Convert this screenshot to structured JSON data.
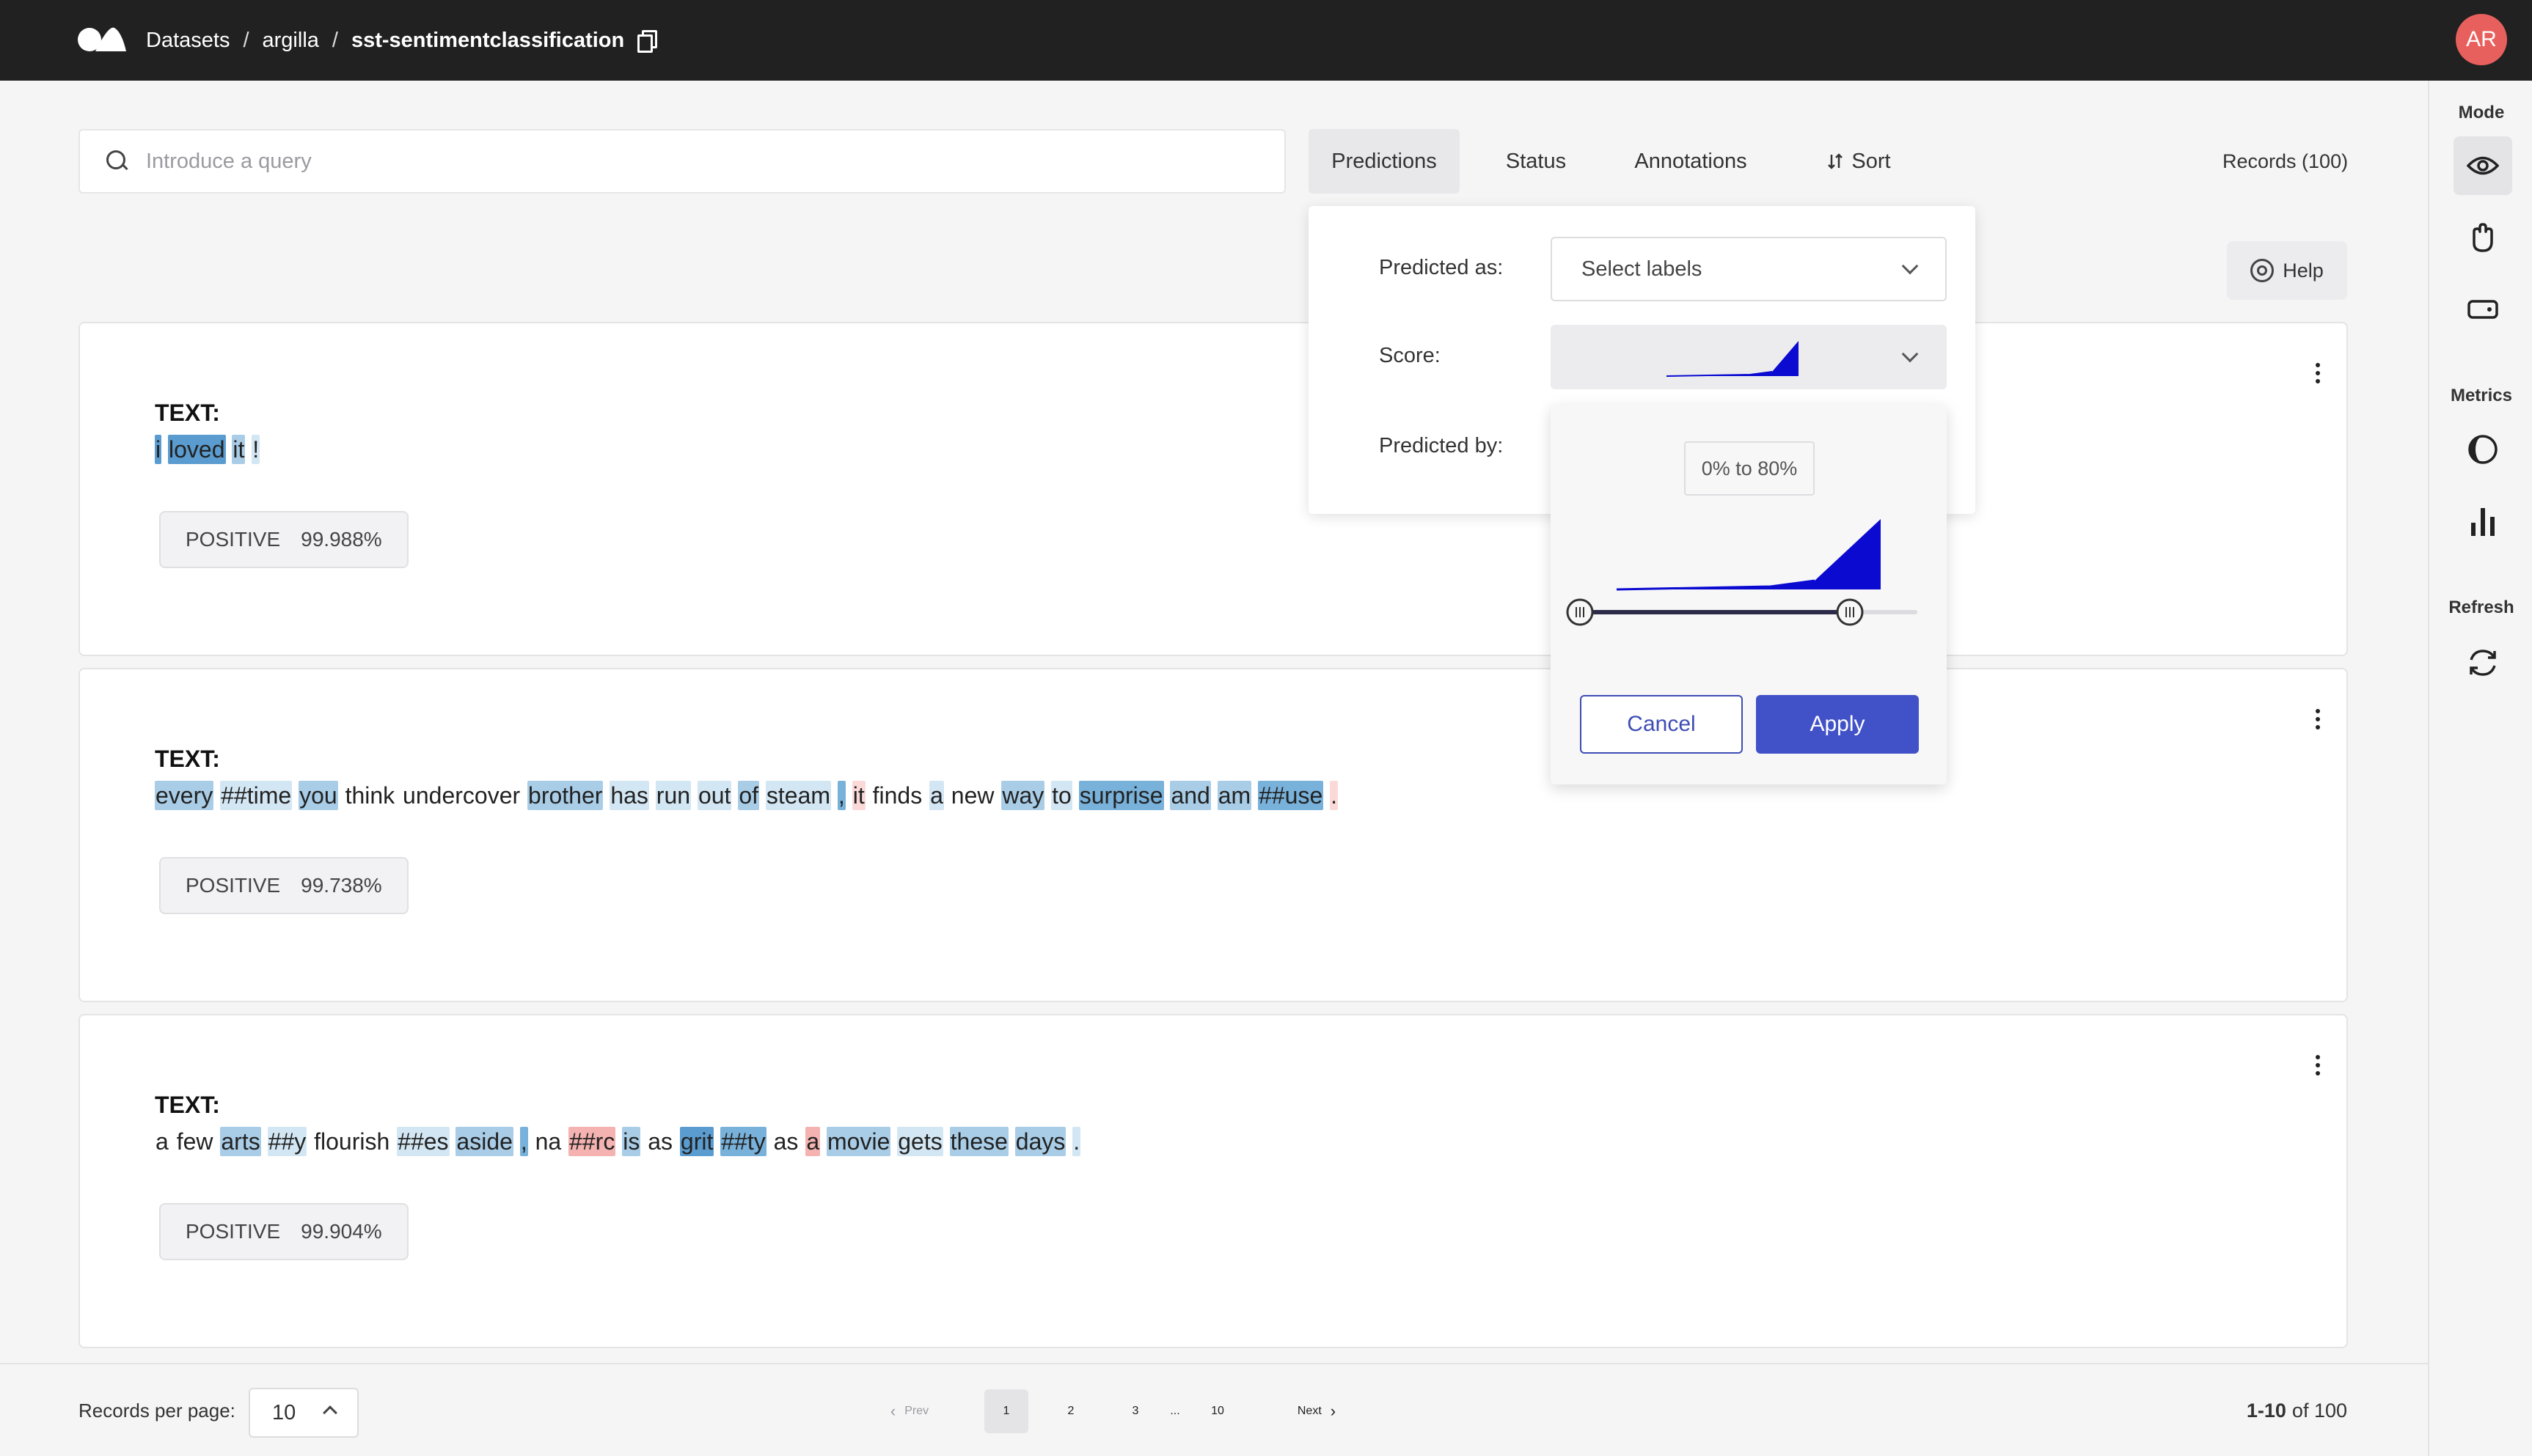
{
  "breadcrumb": {
    "root": "Datasets",
    "workspace": "argilla",
    "dataset": "sst-sentimentclassification"
  },
  "user": {
    "initials": "AR",
    "avatar_color": "#e8605d"
  },
  "search": {
    "placeholder": "Introduce a query",
    "value": ""
  },
  "filters": {
    "predictions": "Predictions",
    "status": "Status",
    "annotations": "Annotations",
    "sort": "Sort"
  },
  "records_count": "Records (100)",
  "help_label": "Help",
  "sidebar": {
    "mode_title": "Mode",
    "metrics_title": "Metrics",
    "refresh_title": "Refresh",
    "mode_icons": [
      "eye-icon",
      "hand-icon",
      "tag-icon"
    ],
    "metrics_icons": [
      "progress-icon",
      "bar-chart-icon"
    ],
    "refresh_icons": [
      "refresh-icon"
    ]
  },
  "records": [
    {
      "label": "TEXT:",
      "prediction": {
        "label": "POSITIVE",
        "score": "99.988%"
      },
      "tokens": [
        [
          "i",
          "h4"
        ],
        [
          "loved",
          "h4"
        ],
        [
          "it",
          "h2"
        ],
        [
          "!",
          "h1"
        ]
      ]
    },
    {
      "label": "TEXT:",
      "prediction": {
        "label": "POSITIVE",
        "score": "99.738%"
      },
      "tokens": [
        [
          "every",
          "h2"
        ],
        [
          "##time",
          "h1"
        ],
        [
          "you",
          "h2"
        ],
        [
          "think",
          ""
        ],
        [
          "undercover",
          ""
        ],
        [
          "brother",
          "h2"
        ],
        [
          "has",
          "h1"
        ],
        [
          "run",
          "h1"
        ],
        [
          "out",
          "h1"
        ],
        [
          "of",
          "h2"
        ],
        [
          "steam",
          "h1"
        ],
        [
          ",",
          "h3"
        ],
        [
          "it",
          "r1"
        ],
        [
          "finds",
          ""
        ],
        [
          "a",
          "h1"
        ],
        [
          "new",
          ""
        ],
        [
          "way",
          "h2"
        ],
        [
          "to",
          "h1"
        ],
        [
          "surprise",
          "h3"
        ],
        [
          "and",
          "h2"
        ],
        [
          "am",
          "h2"
        ],
        [
          "##use",
          "h3"
        ],
        [
          ".",
          "r1"
        ]
      ]
    },
    {
      "label": "TEXT:",
      "prediction": {
        "label": "POSITIVE",
        "score": "99.904%"
      },
      "tokens": [
        [
          "a",
          ""
        ],
        [
          "few",
          ""
        ],
        [
          "arts",
          "h2"
        ],
        [
          "##y",
          "h1"
        ],
        [
          "flourish",
          ""
        ],
        [
          "##es",
          "h1"
        ],
        [
          "aside",
          "h2"
        ],
        [
          ",",
          "h3"
        ],
        [
          "na",
          ""
        ],
        [
          "##rc",
          "r2"
        ],
        [
          "is",
          "h2"
        ],
        [
          "as",
          ""
        ],
        [
          "grit",
          "h4"
        ],
        [
          "##ty",
          "h3"
        ],
        [
          "as",
          ""
        ],
        [
          "a",
          "r2"
        ],
        [
          "movie",
          "h2"
        ],
        [
          "gets",
          "h1"
        ],
        [
          "these",
          "h2"
        ],
        [
          "days",
          "h2"
        ],
        [
          ".",
          "h1"
        ]
      ]
    }
  ],
  "pagination": {
    "rpp_label": "Records per page:",
    "rpp_value": "10",
    "prev": "Prev",
    "next": "Next",
    "pages": [
      "1",
      "2",
      "3",
      "...",
      "10"
    ],
    "current_page": "1",
    "range_bold": "1-10",
    "range_rest": "of 100"
  },
  "predictions_panel": {
    "predicted_as_label": "Predicted as:",
    "predicted_as_placeholder": "Select labels",
    "score_label": "Score:",
    "predicted_by_label": "Predicted by:",
    "score_range": "0% to 80%",
    "range_min_fraction": 0.0,
    "range_max_fraction": 0.8,
    "cancel": "Cancel",
    "apply": "Apply",
    "accent": "#4151c8",
    "histogram_color": "#0a0ad0"
  }
}
